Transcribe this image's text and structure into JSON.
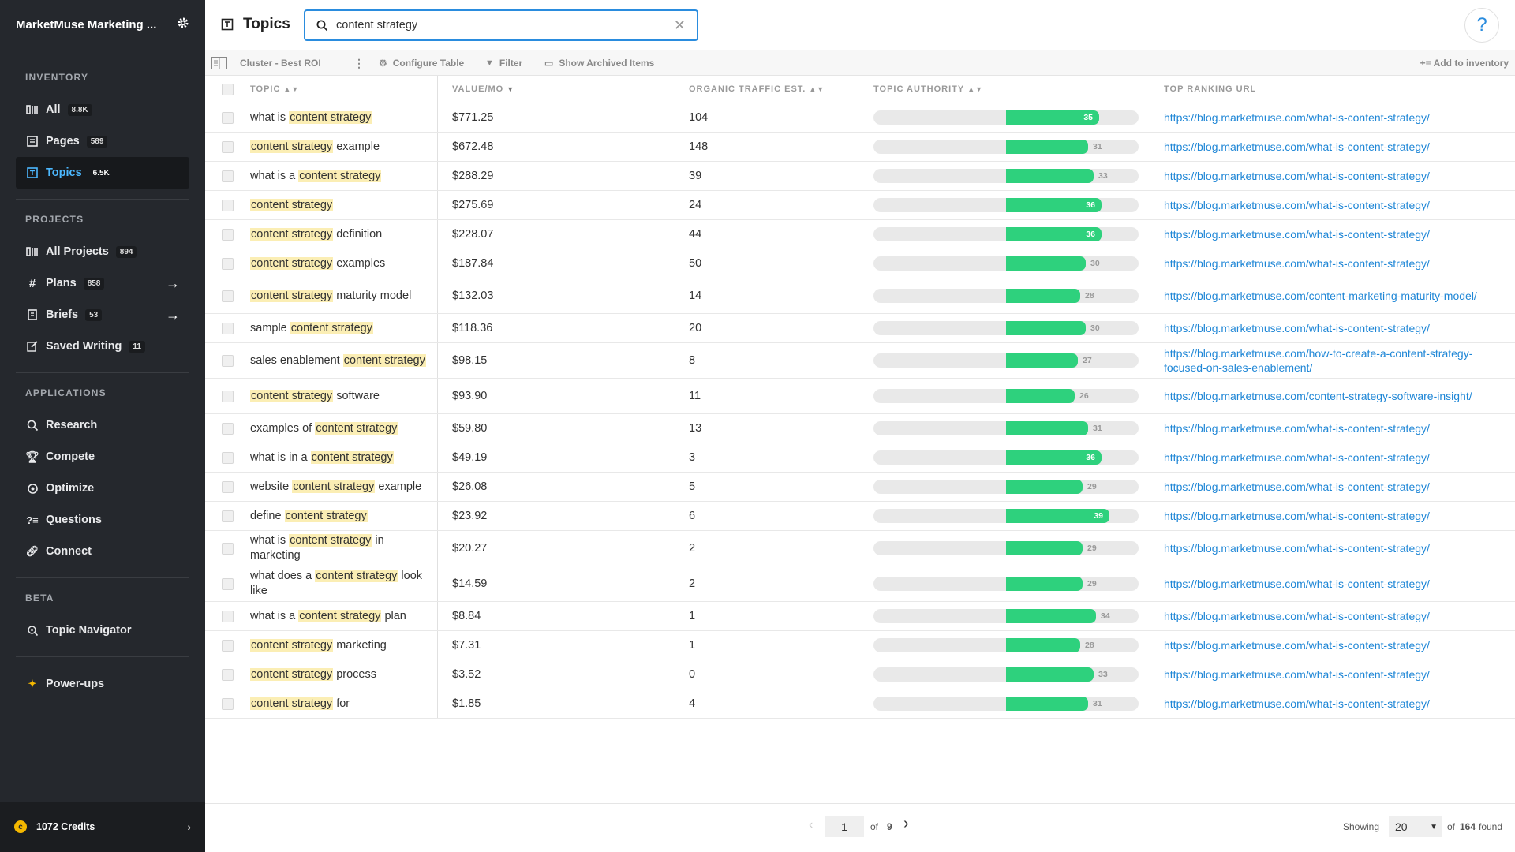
{
  "app": {
    "name": "MarketMuse Marketing ..."
  },
  "sidebar": {
    "sections": {
      "inventory": "INVENTORY",
      "projects": "PROJECTS",
      "applications": "APPLICATIONS",
      "beta": "BETA"
    },
    "inventory": [
      {
        "label": "All",
        "badge": "8.8K",
        "icon": "columns-icon"
      },
      {
        "label": "Pages",
        "badge": "589",
        "icon": "pages-icon"
      },
      {
        "label": "Topics",
        "badge": "6.5K",
        "icon": "topics-icon",
        "active": true
      }
    ],
    "projects": [
      {
        "label": "All Projects",
        "badge": "894",
        "icon": "columns-icon"
      },
      {
        "label": "Plans",
        "badge": "858",
        "icon": "hash-icon"
      },
      {
        "label": "Briefs",
        "badge": "53",
        "icon": "brief-icon"
      },
      {
        "label": "Saved Writing",
        "badge": "11",
        "icon": "edit-icon"
      }
    ],
    "applications": [
      {
        "label": "Research",
        "icon": "research-icon"
      },
      {
        "label": "Compete",
        "icon": "trophy-icon"
      },
      {
        "label": "Optimize",
        "icon": "optimize-icon"
      },
      {
        "label": "Questions",
        "icon": "questions-icon"
      },
      {
        "label": "Connect",
        "icon": "link-icon"
      }
    ],
    "beta": [
      {
        "label": "Topic Navigator",
        "icon": "navigator-icon"
      }
    ],
    "powerups": "Power-ups",
    "credits": "1072 Credits"
  },
  "header": {
    "title": "Topics",
    "search_value": "content strategy",
    "help": "?"
  },
  "toolbar": {
    "cluster": "Cluster - Best ROI",
    "configure": "Configure Table",
    "filter": "Filter",
    "archived": "Show Archived Items",
    "add": "Add to inventory"
  },
  "columns": {
    "topic": "TOPIC",
    "value": "VALUE/MO",
    "traffic": "ORGANIC TRAFFIC EST.",
    "authority": "TOPIC AUTHORITY",
    "url": "TOP RANKING URL"
  },
  "rows": [
    {
      "pre": "what is ",
      "hl": "content strategy",
      "post": "",
      "value": "$771.25",
      "traffic": "104",
      "authority": 35,
      "url": "https://blog.marketmuse.com/what-is-content-strategy/"
    },
    {
      "pre": "",
      "hl": "content strategy",
      "post": " example",
      "value": "$672.48",
      "traffic": "148",
      "authority": 31,
      "url": "https://blog.marketmuse.com/what-is-content-strategy/"
    },
    {
      "pre": "what is a ",
      "hl": "content strategy",
      "post": "",
      "value": "$288.29",
      "traffic": "39",
      "authority": 33,
      "url": "https://blog.marketmuse.com/what-is-content-strategy/"
    },
    {
      "pre": "",
      "hl": "content strategy",
      "post": "",
      "value": "$275.69",
      "traffic": "24",
      "authority": 36,
      "url": "https://blog.marketmuse.com/what-is-content-strategy/"
    },
    {
      "pre": "",
      "hl": "content strategy",
      "post": " definition",
      "value": "$228.07",
      "traffic": "44",
      "authority": 36,
      "url": "https://blog.marketmuse.com/what-is-content-strategy/"
    },
    {
      "pre": "",
      "hl": "content strategy",
      "post": " examples",
      "value": "$187.84",
      "traffic": "50",
      "authority": 30,
      "url": "https://blog.marketmuse.com/what-is-content-strategy/"
    },
    {
      "pre": "",
      "hl": "content strategy",
      "post": " maturity model",
      "value": "$132.03",
      "traffic": "14",
      "authority": 28,
      "url": "https://blog.marketmuse.com/content-marketing-maturity-model/"
    },
    {
      "pre": "sample ",
      "hl": "content strategy",
      "post": "",
      "value": "$118.36",
      "traffic": "20",
      "authority": 30,
      "url": "https://blog.marketmuse.com/what-is-content-strategy/"
    },
    {
      "pre": "sales enablement ",
      "hl": "content strategy",
      "post": "",
      "value": "$98.15",
      "traffic": "8",
      "authority": 27,
      "url": "https://blog.marketmuse.com/how-to-create-a-content-strategy-focused-on-sales-enablement/"
    },
    {
      "pre": "",
      "hl": "content strategy",
      "post": " software",
      "value": "$93.90",
      "traffic": "11",
      "authority": 26,
      "url": "https://blog.marketmuse.com/content-strategy-software-insight/"
    },
    {
      "pre": "examples of ",
      "hl": "content strategy",
      "post": "",
      "value": "$59.80",
      "traffic": "13",
      "authority": 31,
      "url": "https://blog.marketmuse.com/what-is-content-strategy/"
    },
    {
      "pre": "what is in a ",
      "hl": "content strategy",
      "post": "",
      "value": "$49.19",
      "traffic": "3",
      "authority": 36,
      "url": "https://blog.marketmuse.com/what-is-content-strategy/"
    },
    {
      "pre": "website ",
      "hl": "content strategy",
      "post": " example",
      "value": "$26.08",
      "traffic": "5",
      "authority": 29,
      "url": "https://blog.marketmuse.com/what-is-content-strategy/"
    },
    {
      "pre": "define ",
      "hl": "content strategy",
      "post": "",
      "value": "$23.92",
      "traffic": "6",
      "authority": 39,
      "url": "https://blog.marketmuse.com/what-is-content-strategy/"
    },
    {
      "pre": "what is ",
      "hl": "content strategy",
      "post": " in marketing",
      "value": "$20.27",
      "traffic": "2",
      "authority": 29,
      "url": "https://blog.marketmuse.com/what-is-content-strategy/"
    },
    {
      "pre": "what does a ",
      "hl": "content strategy",
      "post": " look like",
      "value": "$14.59",
      "traffic": "2",
      "authority": 29,
      "url": "https://blog.marketmuse.com/what-is-content-strategy/"
    },
    {
      "pre": "what is a ",
      "hl": "content strategy",
      "post": " plan",
      "value": "$8.84",
      "traffic": "1",
      "authority": 34,
      "url": "https://blog.marketmuse.com/what-is-content-strategy/"
    },
    {
      "pre": "",
      "hl": "content strategy",
      "post": " marketing",
      "value": "$7.31",
      "traffic": "1",
      "authority": 28,
      "url": "https://blog.marketmuse.com/what-is-content-strategy/"
    },
    {
      "pre": "",
      "hl": "content strategy",
      "post": " process",
      "value": "$3.52",
      "traffic": "0",
      "authority": 33,
      "url": "https://blog.marketmuse.com/what-is-content-strategy/"
    },
    {
      "pre": "",
      "hl": "content strategy",
      "post": " for",
      "value": "$1.85",
      "traffic": "4",
      "authority": 31,
      "url": "https://blog.marketmuse.com/what-is-content-strategy/"
    }
  ],
  "pager": {
    "page": "1",
    "of_label": "of",
    "total_pages": "9",
    "showing_label": "Showing",
    "per_page": "20",
    "of_label2": "of",
    "found_count": "164",
    "found_label": "found"
  },
  "colors": {
    "accent": "#2a8cde",
    "bar": "#2ed17d",
    "sidebar": "#25282d"
  }
}
